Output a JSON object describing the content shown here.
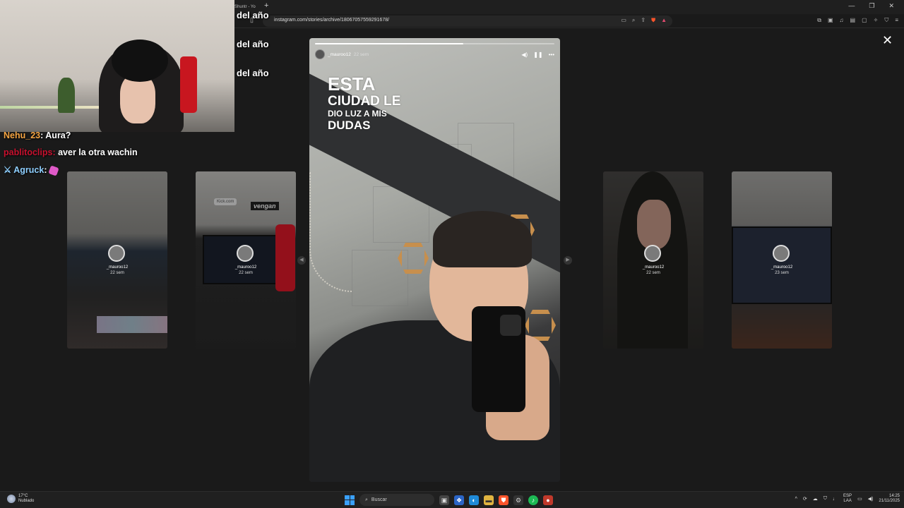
{
  "browser": {
    "tab_title": "Shuntr - Yo",
    "new_tab": "+",
    "url": "instagram.com/stories/archive/18067057559291678/",
    "window_controls": [
      "—",
      "❐",
      "✕"
    ]
  },
  "story": {
    "username": "_mauroo12",
    "age": "22 sem",
    "progress": 0.62,
    "caption_lines": [
      "ESTA",
      "CIUDAD LE",
      "DIO LUZ A MIS",
      "DUDAS"
    ]
  },
  "side_cards": [
    {
      "username": "_mauroo12",
      "age": "22 sem"
    },
    {
      "username": "_mauroo12",
      "age": "22 sem",
      "tag": "Kick.com",
      "sticker": "vengan"
    },
    {
      "username": "_mauroo12",
      "age": "22 sem"
    },
    {
      "username": "_mauroo12",
      "age": "23 sem"
    }
  ],
  "stream_overlay": {
    "labels": [
      "del año",
      "del año",
      "del año"
    ],
    "chat": [
      {
        "user": "Nehu_23",
        "sep": ": ",
        "message": "Aura?",
        "color": "#f5a442"
      },
      {
        "user": "pablitoclips",
        "sep": ": ",
        "message": "aver la otra wachin",
        "color": "#c8102e"
      },
      {
        "user": "Agruck",
        "sep": ": ",
        "message": "",
        "color": "#8ecfff"
      }
    ]
  },
  "close_icon": "✕",
  "taskbar": {
    "weather_temp": "17°C",
    "weather_desc": "Nublado",
    "search_placeholder": "Buscar",
    "lang_top": "ESP",
    "lang_bottom": "LAA",
    "time": "14:25",
    "date": "21/11/2025"
  }
}
